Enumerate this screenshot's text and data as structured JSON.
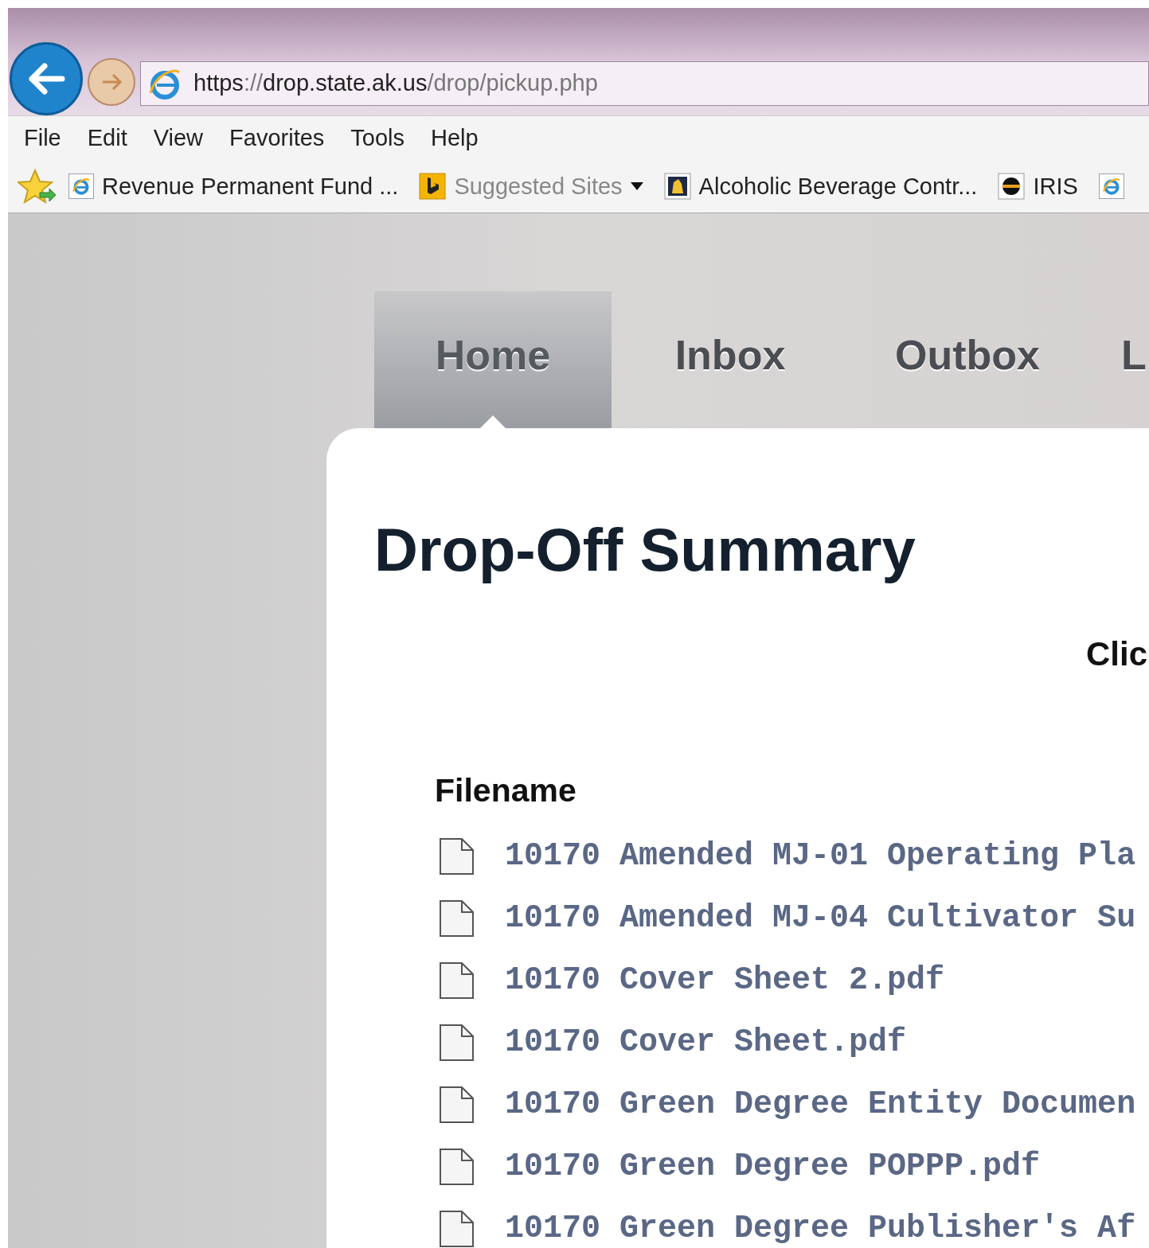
{
  "browser": {
    "url": {
      "scheme": "https://",
      "host": "drop.state.ak.us",
      "path": "/drop/pickup.php"
    },
    "menu": [
      "File",
      "Edit",
      "View",
      "Favorites",
      "Tools",
      "Help"
    ],
    "favorites": [
      {
        "kind": "ie",
        "label": "Revenue Permanent Fund ..."
      },
      {
        "kind": "bing",
        "label": "Suggested Sites"
      },
      {
        "kind": "badge",
        "label": "Alcoholic Beverage Contr..."
      },
      {
        "kind": "globe",
        "label": "IRIS"
      },
      {
        "kind": "ie"
      }
    ]
  },
  "tabs": [
    {
      "label": "Home",
      "selected": true
    },
    {
      "label": "Inbox",
      "selected": false
    },
    {
      "label": "Outbox",
      "selected": false
    },
    {
      "label": "L",
      "selected": false
    }
  ],
  "card": {
    "title": "Drop-Off Summary",
    "prompt": "Clic",
    "column_header": "Filename",
    "files": [
      "10170 Amended MJ-01 Operating Pla",
      "10170 Amended MJ-04 Cultivator Su",
      "10170 Cover Sheet 2.pdf",
      "10170 Cover Sheet.pdf",
      "10170 Green Degree Entity Documen",
      "10170 Green Degree POPPP.pdf",
      "10170 Green Degree Publisher's Af"
    ]
  }
}
